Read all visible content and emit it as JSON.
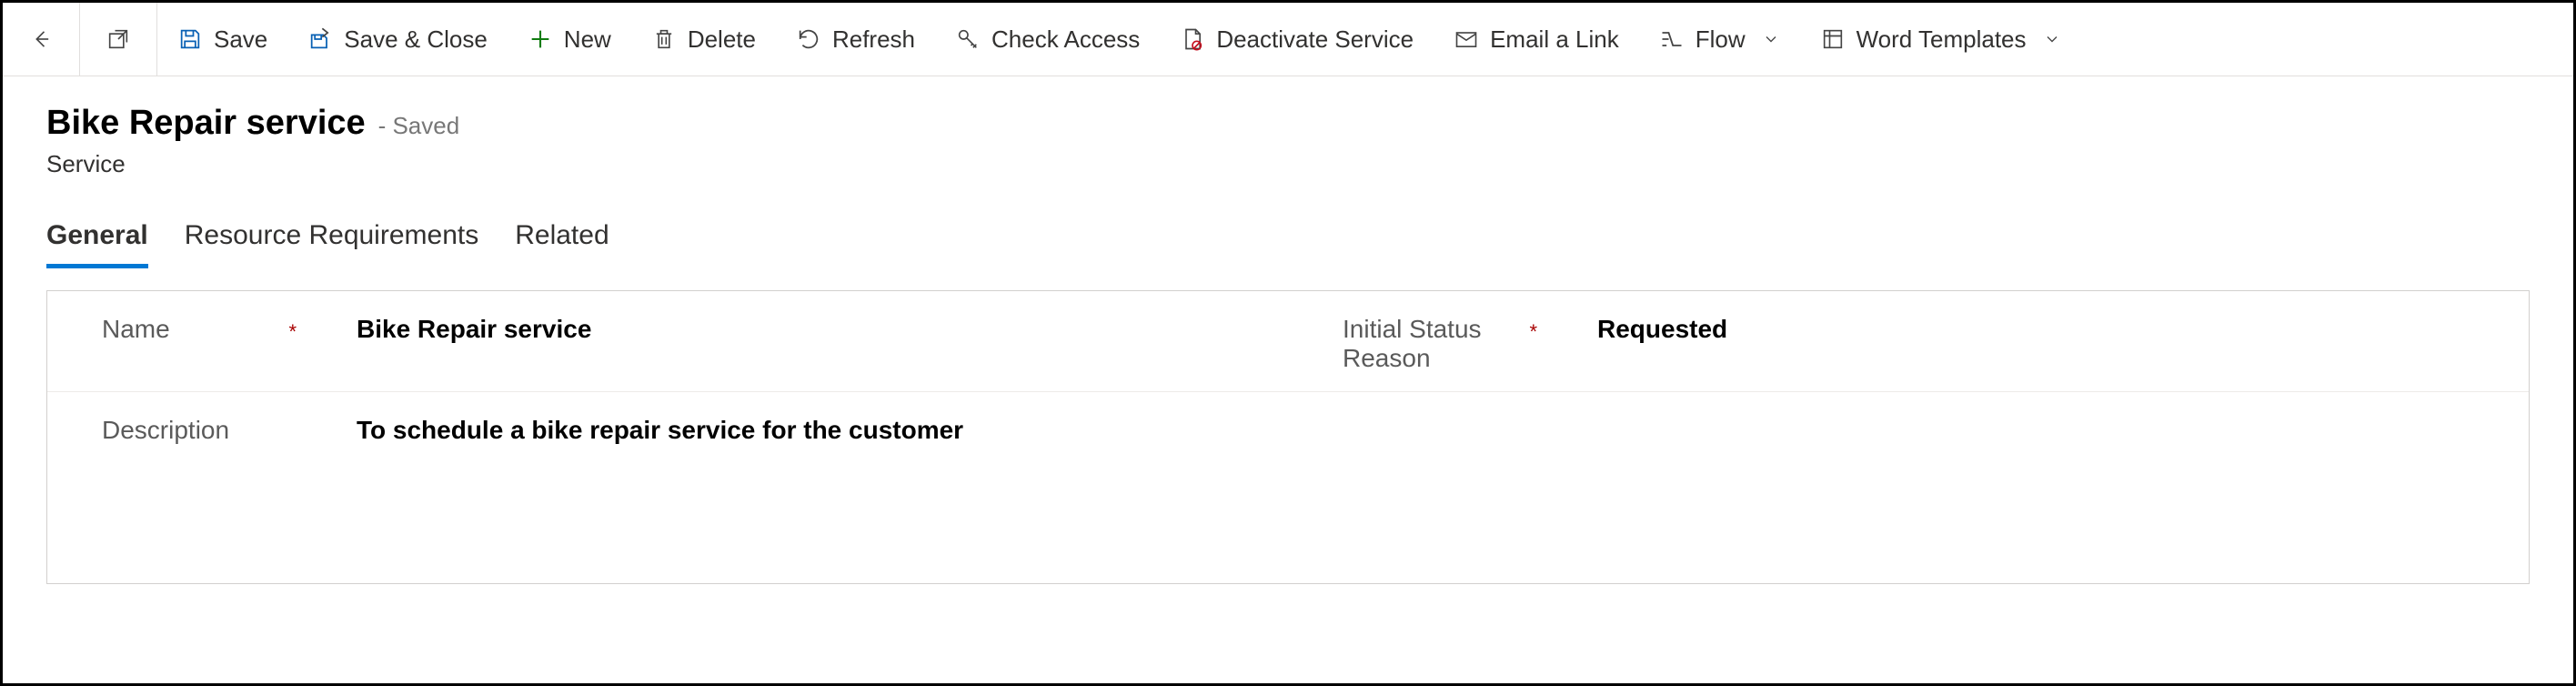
{
  "toolbar": {
    "save": "Save",
    "saveClose": "Save & Close",
    "new": "New",
    "delete": "Delete",
    "refresh": "Refresh",
    "checkAccess": "Check Access",
    "deactivate": "Deactivate Service",
    "emailLink": "Email a Link",
    "flow": "Flow",
    "wordTemplates": "Word Templates"
  },
  "header": {
    "title": "Bike Repair service",
    "status": "- Saved",
    "entityType": "Service"
  },
  "tabs": [
    {
      "label": "General",
      "active": true
    },
    {
      "label": "Resource Requirements",
      "active": false
    },
    {
      "label": "Related",
      "active": false
    }
  ],
  "form": {
    "nameLabel": "Name",
    "nameValue": "Bike Repair service",
    "statusLabel": "Initial Status Reason",
    "statusValue": "Requested",
    "descriptionLabel": "Description",
    "descriptionValue": "To schedule a bike repair service for the customer",
    "requiredMark": "*"
  }
}
